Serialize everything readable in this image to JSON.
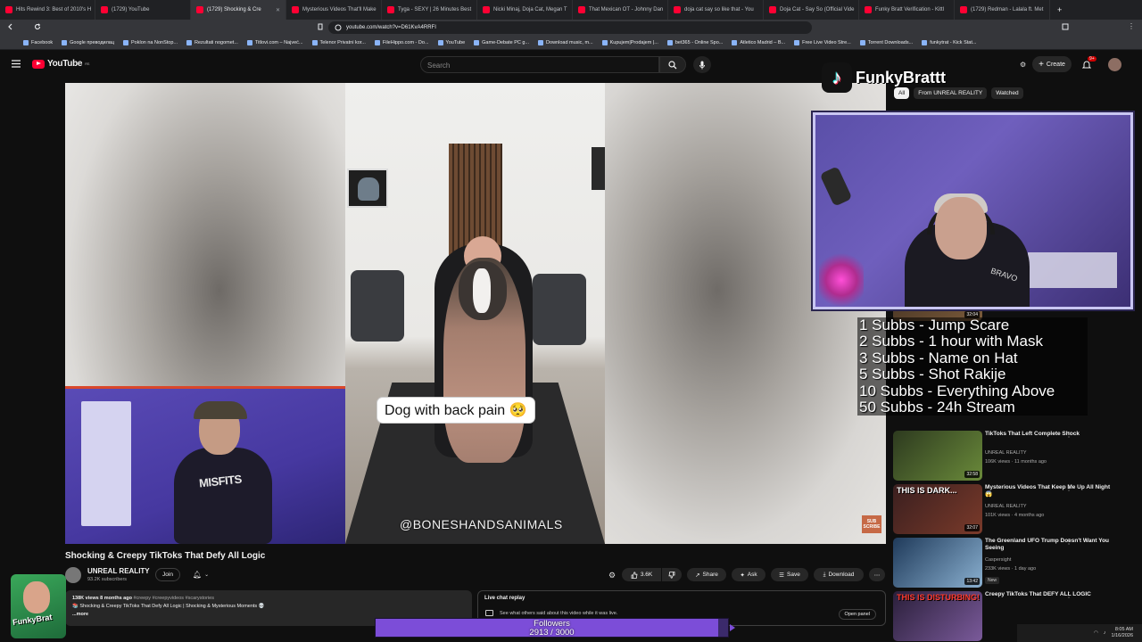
{
  "browser": {
    "tabs": [
      {
        "label": "Hits Rewind 3: Best of 2010's H",
        "active": false
      },
      {
        "label": "(1729) YouTube",
        "active": false
      },
      {
        "label": "(1729) Shocking & Cre",
        "active": true
      },
      {
        "label": "Mysterious Videos That'll Make",
        "active": false
      },
      {
        "label": "Tyga - SEXY | 26 Minutes Best",
        "active": false
      },
      {
        "label": "Nicki Minaj, Doja Cat, Megan T",
        "active": false
      },
      {
        "label": "That Mexican OT - Johnny Dan",
        "active": false
      },
      {
        "label": "doja cat say so like that - You",
        "active": false
      },
      {
        "label": "Doja Cat - Say So (Official Vide",
        "active": false
      },
      {
        "label": "Funky Bratt Verification - Kittl",
        "active": false
      },
      {
        "label": "(1729) Redman - Lalala ft. Met",
        "active": false
      }
    ],
    "url": "youtube.com/watch?v=D61KvA4RRFI",
    "bookmarks": [
      "Facebook",
      "Google преводилац",
      "Poklon na NonStop...",
      "Rezultati nogomet...",
      "Titlovi.com – Najveć...",
      "Telenor Privatni kor...",
      "FileHippo.com - Do...",
      "YouTube",
      "Game-Debate PC g...",
      "Download music, m...",
      "Kupujem|Prodajem |...",
      "bet365 - Online Spo...",
      "Atletico Madrid – B...",
      "Free Live Video Stre...",
      "Torrent Downloads...",
      "funkytrat - Kick Stat..."
    ]
  },
  "youtube": {
    "logo_text": "YouTube",
    "logo_sup": "RS",
    "search_placeholder": "Search",
    "create_label": "Create",
    "notif_count": "9+"
  },
  "video": {
    "caption": "Dog with back pain 🥺",
    "watermark": "@BONESHANDSANIMALS",
    "corner_badge": "SUB SCRIBE",
    "streamer_shirt": "MISFITS"
  },
  "meta": {
    "title": "Shocking & Creepy TikToks That Defy All Logic",
    "channel": "UNREAL REALITY",
    "subscribers": "93.2K subscribers",
    "join": "Join",
    "likes": "3.6K",
    "share": "Share",
    "ask": "Ask",
    "save": "Save",
    "download": "Download",
    "desc_stats": "138K views  8 months ago",
    "desc_tags": "#creepy #creepyvideos #scarystories",
    "desc_line": "📚 Shocking & Creepy TikToks That Defy All Logic | Shocking & Mysterious Moments 💀",
    "desc_more": "...more",
    "livechat_title": "Live chat replay",
    "livechat_sub": "See what others said about this video while it was live.",
    "open_panel": "Open panel"
  },
  "chips": [
    "All",
    "From UNREAL REALITY",
    "Watched"
  ],
  "recommendations": [
    {
      "title": "TikToks That Left Complete Shock",
      "channel": "UNREAL REALITY",
      "meta": "106K views · 11 months ago",
      "duration": "32:58",
      "overlay": "",
      "badge": ""
    },
    {
      "title": "Mysterious Videos That Keep Me Up All Night 😱",
      "channel": "UNREAL REALITY",
      "meta": "101K views · 4 months ago",
      "duration": "32:07",
      "overlay": "THIS IS DARK...",
      "badge": ""
    },
    {
      "title": "The Greenland UFO Trump Doesn't Want You Seeing",
      "channel": "Caspersight",
      "meta": "233K views · 1 day ago",
      "duration": "13:42",
      "overlay": "",
      "badge": "New"
    },
    {
      "title": "Creepy TikToks That DEFY ALL LOGIC",
      "channel": "",
      "meta": "",
      "duration": "",
      "overlay": "THIS IS DISTURBING!",
      "badge": ""
    }
  ],
  "thumb_top_duration": "32:04",
  "stream": {
    "tiktok_name": "FunkyBrattt",
    "sub_goals": [
      "1 Subbs - Jump Scare",
      "2 Subbs - 1 hour with Mask",
      "3 Subbs - Name on Hat",
      "5 Subbs - Shot Rakije",
      "10 Subbs - Everything Above",
      "50 Subbs - 24h Stream"
    ],
    "followers_label": "Followers",
    "followers_current": 2913,
    "followers_goal": 3000,
    "followers_text": "2913 / 3000",
    "avatar_text": "FunkyBrat",
    "webcam_sign": "BRAVO"
  },
  "tray": {
    "time": "8:05 AM",
    "date": "1/16/2026"
  },
  "colors": {
    "youtube_red": "#ff0033",
    "follower_bar": "#7c4dd8",
    "subgoal_bg": "#000000"
  }
}
